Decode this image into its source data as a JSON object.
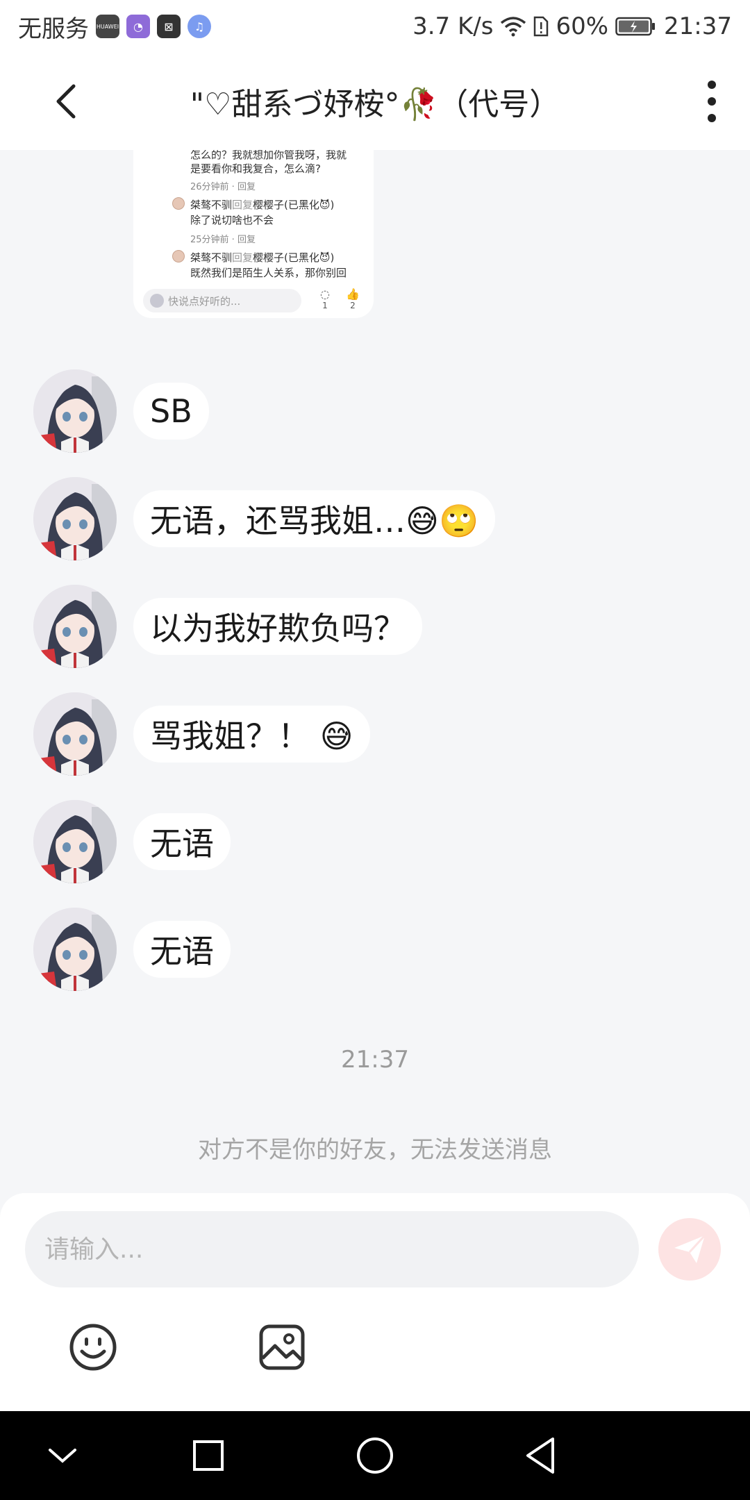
{
  "status_bar": {
    "carrier": "无服务",
    "speed": "3.7 K/s",
    "battery": "60%",
    "time": "21:37",
    "app_icons": [
      "huawei-app-icon",
      "purple-app-icon",
      "capcut-icon",
      "music-icon"
    ],
    "huawei_label": "HUAWEI"
  },
  "header": {
    "title": "\"♡甜系づ妤桉°🥀（代号）",
    "back_icon": "chevron-left-icon",
    "more_icon": "more-vertical-icon"
  },
  "shared_card": {
    "line1": "怎么的？我就想加你管我呀，我就",
    "line2": "是要看你和我复合，怎么滴?",
    "meta1": "26分钟前 · 回复",
    "reply1_user": "桀骜不驯",
    "reply1_verb": "回复",
    "reply1_target": "樱樱子(已黑化😈)",
    "reply1_text": "除了说切啥也不会",
    "meta2": "25分钟前 · 回复",
    "reply2_user": "桀骜不驯",
    "reply2_verb": "回复",
    "reply2_target": "樱樱子(已黑化😈)",
    "reply2_text": "既然我们是陌生人关系，那你别回",
    "input_placeholder": "快说点好听的...",
    "comment_count": "1",
    "like_count": "2"
  },
  "messages": [
    {
      "text": "SB"
    },
    {
      "text": "无语，还骂我姐…😅🙄"
    },
    {
      "text": "以为我好欺负吗？"
    },
    {
      "text": "骂我姐？！ 😅"
    },
    {
      "text": "无语"
    },
    {
      "text": "无语"
    }
  ],
  "timestamp": "21:37",
  "system_note": "对方不是你的好友，无法发送消息",
  "composer": {
    "placeholder": "请输入...",
    "send_icon": "send-icon",
    "emoji_icon": "emoji-icon",
    "image_icon": "image-icon"
  },
  "nav_bar": {
    "icons": [
      "chevron-down-icon",
      "square-icon",
      "circle-icon",
      "triangle-back-icon"
    ]
  },
  "colors": {
    "background": "#f5f6f8",
    "bubble": "#ffffff",
    "send_button": "#fde3e3",
    "muted_text": "#a5a5a5"
  }
}
